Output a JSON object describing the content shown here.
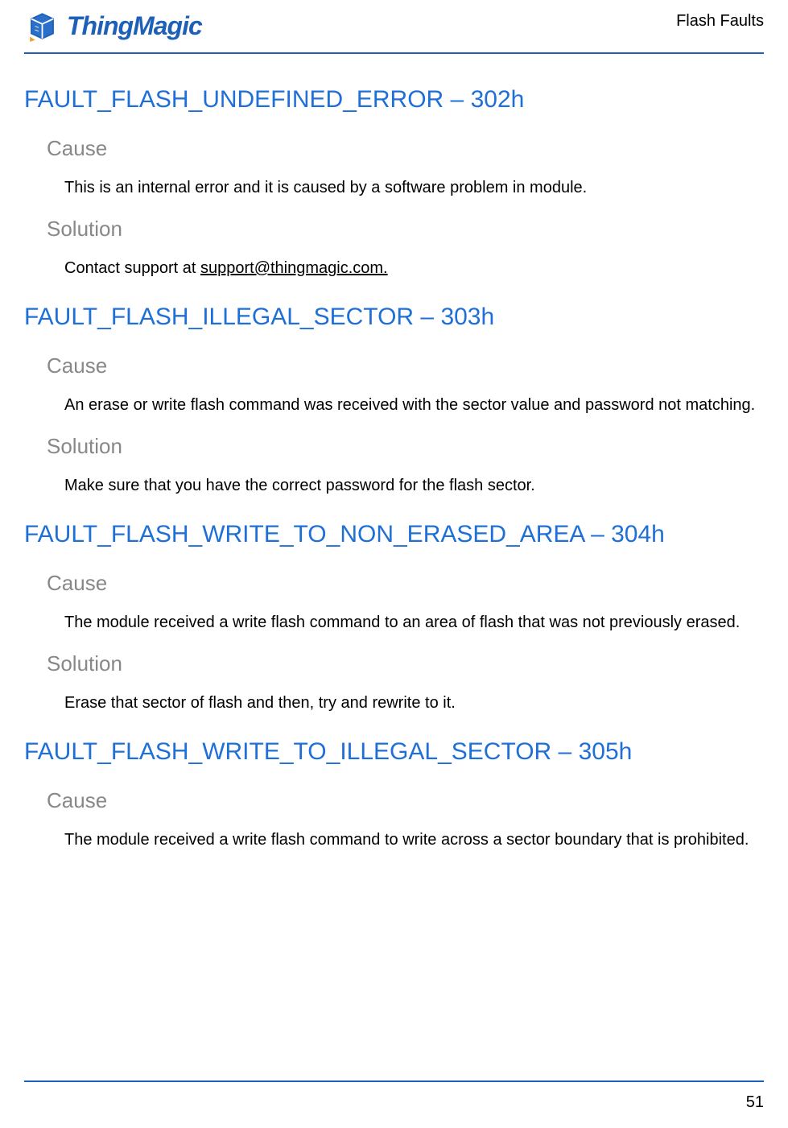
{
  "header": {
    "brand": "ThingMagic",
    "right_text": "Flash Faults"
  },
  "sections": {
    "s302": {
      "title": "FAULT_FLASH_UNDEFINED_ERROR – 302h",
      "cause_label": "Cause",
      "cause_text": "This is an internal error and it is caused by a software problem in module.",
      "solution_label": "Solution",
      "solution_prefix": "Contact support at ",
      "solution_link": "support@thingmagic.com."
    },
    "s303": {
      "title": "FAULT_FLASH_ILLEGAL_SECTOR – 303h",
      "cause_label": "Cause",
      "cause_text": "An erase or write flash command was received with the sector value and password not matching.",
      "solution_label": "Solution",
      "solution_text": "Make sure that you have the correct password for the flash sector."
    },
    "s304": {
      "title": "FAULT_FLASH_WRITE_TO_NON_ERASED_AREA – 304h",
      "cause_label": "Cause",
      "cause_text": "The module received a write flash command to an area of flash that was not previously erased.",
      "solution_label": "Solution",
      "solution_text": "Erase that sector of flash and then, try and rewrite to it."
    },
    "s305": {
      "title": "FAULT_FLASH_WRITE_TO_ILLEGAL_SECTOR – 305h",
      "cause_label": "Cause",
      "cause_text": "The module received a write flash command to write across a sector boundary that is prohibited."
    }
  },
  "footer": {
    "page_number": "51"
  }
}
